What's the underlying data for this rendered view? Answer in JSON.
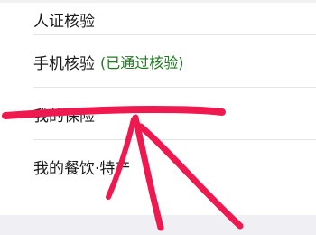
{
  "settings_list": {
    "items": [
      {
        "label": "人证核验",
        "status": ""
      },
      {
        "label": "手机核验",
        "status": "(已通过核验)"
      },
      {
        "label": "我的保险",
        "status": ""
      },
      {
        "label": "我的餐饮·特产",
        "status": ""
      }
    ]
  },
  "colors": {
    "status_verified": "#1f7a1f",
    "annotation_stroke": "#f0194f",
    "background": "#ffffff",
    "bottom_area": "#efeff4"
  }
}
